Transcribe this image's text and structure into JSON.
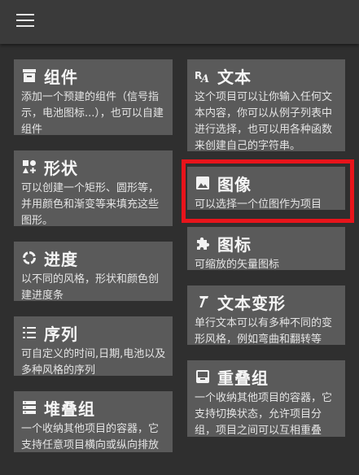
{
  "left_cards": [
    {
      "title": "组件",
      "desc": "添加一个预建的组件（信号指示，电池图标...），也可以自建组件"
    },
    {
      "title": "形状",
      "desc": "可以创建一个矩形、圆形等，并用颜色和渐变等来填充这些图形。"
    },
    {
      "title": "进度",
      "desc": "以不同的风格，形状和颜色创建进度条"
    },
    {
      "title": "序列",
      "desc": "可自定义的时间,日期,电池以及多种风格的序列"
    },
    {
      "title": "堆叠组",
      "desc": "一个收纳其他项目的容器，它支持任意项目横向或纵向排放"
    }
  ],
  "right_cards": [
    {
      "title": "文本",
      "desc": "这个项目可以让你输入任何文本内容，你可以从例子列表中进行选择，也可以用各种函数来创建自己的字符串。"
    },
    {
      "title": "图像",
      "desc": "可以选择一个位图作为项目"
    },
    {
      "title": "图标",
      "desc": "可缩放的矢量图标"
    },
    {
      "title": "文本变形",
      "desc": "单行文本可以有多种不同的变形风格，例如弯曲和翻转等"
    },
    {
      "title": "重叠组",
      "desc": "一个收纳其他项目的容器，它支持切换状态，允许项目分组，项目之间可以互相重叠"
    }
  ],
  "colors": {
    "background": "#2f2f2f",
    "card": "#5a5a5a",
    "highlight": "#e8141b"
  },
  "icons": [
    "menu-icon",
    "component-icon",
    "shape-icon",
    "progress-icon",
    "series-icon",
    "stack-icon",
    "text-icon",
    "image-icon",
    "puzzle-icon",
    "text-transform-icon",
    "overlap-icon"
  ]
}
